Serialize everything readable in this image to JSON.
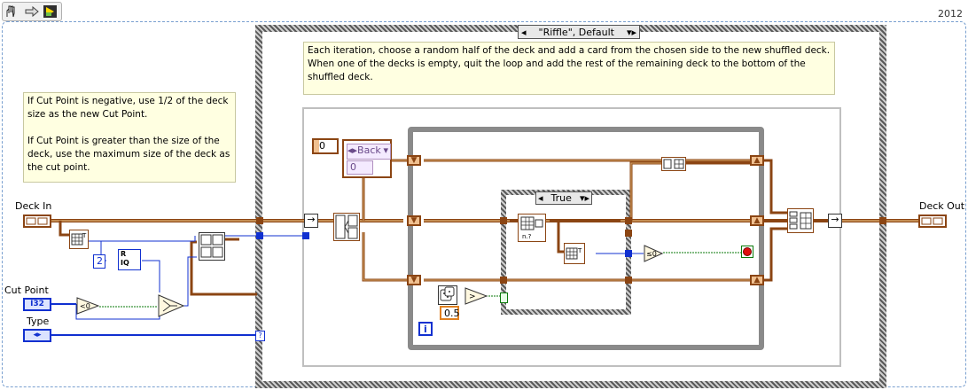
{
  "toolbar": {
    "icons": [
      "hand-icon",
      "arrow-icon",
      "run-icon"
    ],
    "version": "2012"
  },
  "case_structure": {
    "selector": "\"Riffle\", Default"
  },
  "inner_case": {
    "selector": "True"
  },
  "comments": {
    "top": "Each iteration, choose a random half of the deck and add a card from the chosen side to the new shuffled deck.\nWhen one of the decks is empty, quit the loop and add the rest of the remaining deck to the bottom of the\nshuffled deck.",
    "left": "If Cut Point is negative, use 1/2 of the deck\nsize as the new Cut Point.\n\nIf Cut Point is greater than the size of the\ndeck, use the maximum size of the deck as\nthe cut point."
  },
  "terminals": {
    "deck_in": "Deck In",
    "deck_out": "Deck Out",
    "cut_point": "Cut Point",
    "cut_point_type": "I32",
    "type": "Type"
  },
  "constants": {
    "two": "2",
    "zero_index": "0",
    "back_enum": "Back",
    "back_value": "0",
    "half": "0.5",
    "lt_zero": "<0",
    "gt": ">",
    "iteration": "i",
    "divide_label": "R\nIQ",
    "unbundle_t": "T"
  },
  "colors": {
    "cluster_wire": "#8b4513",
    "cluster_wire_light": "#d7a66a",
    "int_wire": "#1030d0",
    "bool_wire": "#0a7a0a",
    "enum_wire": "#1030d0",
    "structure_frame": "#8c8c8c",
    "note_bg": "#ffffe1"
  }
}
